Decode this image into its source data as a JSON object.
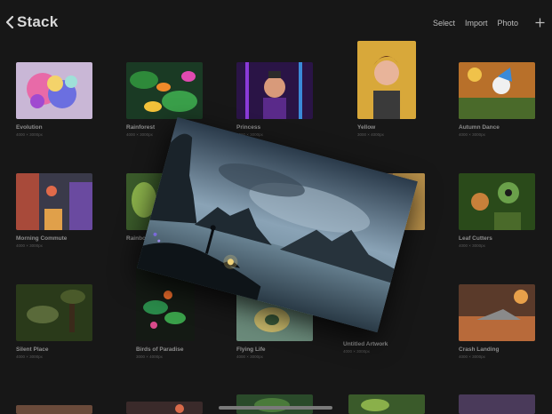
{
  "header": {
    "back_label": "Stack",
    "actions": {
      "select": "Select",
      "import": "Import",
      "photo": "Photo"
    }
  },
  "artworks": [
    {
      "name": "Evolution",
      "size": "4000 × 3000px"
    },
    {
      "name": "Rainforest",
      "size": "4000 × 3000px"
    },
    {
      "name": "Princess",
      "size": "4000 × 3000px"
    },
    {
      "name": "Yellow",
      "size": "3000 × 4000px"
    },
    {
      "name": "Autumn Dance",
      "size": "4000 × 3000px"
    },
    {
      "name": "Morning Commute",
      "size": "4000 × 3000px"
    },
    {
      "name": "Rainbow",
      "size": ""
    },
    {
      "name": "Leaf Cutters",
      "size": "4000 × 3000px"
    },
    {
      "name": "Silent Place",
      "size": "4000 × 3000px"
    },
    {
      "name": "Birds of Paradise",
      "size": "3000 × 4000px"
    },
    {
      "name": "Flying Life",
      "size": "4000 × 3000px"
    },
    {
      "name": "Untitled Artwork",
      "size": "4000 × 3000px"
    },
    {
      "name": "Crash Landing",
      "size": "4000 × 3000px"
    }
  ],
  "dragged_artwork": {
    "description_colors": {
      "sky": "#8aa3b6",
      "water": "#5f7a8a",
      "accent": "#f0d37a"
    }
  },
  "icons": {
    "back": "chevron-left-icon",
    "add": "plus-icon"
  }
}
